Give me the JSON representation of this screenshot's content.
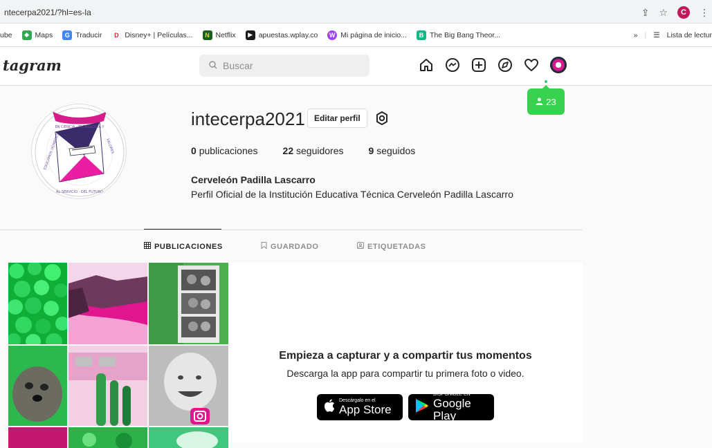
{
  "browser": {
    "url": "ntecerpa2021/?hl=es-la",
    "profile_initial": "C",
    "bookmarks": [
      {
        "label": "ube",
        "color": "#ff0000"
      },
      {
        "label": "Maps",
        "color": "#34a853"
      },
      {
        "label": "Traducir",
        "color": "#4285f4"
      },
      {
        "label": "Disney+ | Películas...",
        "color": "#0b2a7a"
      },
      {
        "label": "Netflix",
        "color": "#e50914"
      },
      {
        "label": "apuestas.wplay.co",
        "color": "#1e8e3e"
      },
      {
        "label": "Mi página de inicio...",
        "color": "#a142f4"
      },
      {
        "label": "The Big Bang Theor...",
        "color": "#12b886"
      }
    ],
    "overflow": "»",
    "reading_list": "Lista de lectur"
  },
  "nav": {
    "logo": "tagram",
    "search_placeholder": "Buscar",
    "notification_count": "23"
  },
  "profile": {
    "username": "intecerpa2021",
    "edit_button": "Editar perfil",
    "stats": {
      "posts_count": "0",
      "posts_label": "publicaciones",
      "followers_count": "22",
      "followers_label": "seguidores",
      "following_count": "9",
      "following_label": "seguidos"
    },
    "full_name": "Cerveleón Padilla Lascarro",
    "bio": "Perfil Oficial de la Institución Educativa Técnica Cerveleón Padilla Lascarro",
    "logo_text": [
      "EN CIENCIA",
      "TECNOLOGIA Y",
      "VALORES",
      "EDUCAMOS HOMBRES",
      "DEL FUTURO",
      "AL",
      "SERVICIO"
    ]
  },
  "tabs": [
    {
      "label": "PUBLICACIONES",
      "active": true
    },
    {
      "label": "GUARDADO",
      "active": false
    },
    {
      "label": "ETIQUETADAS",
      "active": false
    }
  ],
  "empty_state": {
    "title": "Empieza a capturar y a compartir tus momentos",
    "subtitle": "Descarga la app para compartir tu primera foto o video.",
    "app_store_small": "Descárgalo en el",
    "app_store_large": "App Store",
    "google_play_small": "DISPONIBLE EN",
    "google_play_large": "Google Play"
  },
  "colors": {
    "accent_green": "#37d34f",
    "brand_magenta": "#d81b8a"
  }
}
